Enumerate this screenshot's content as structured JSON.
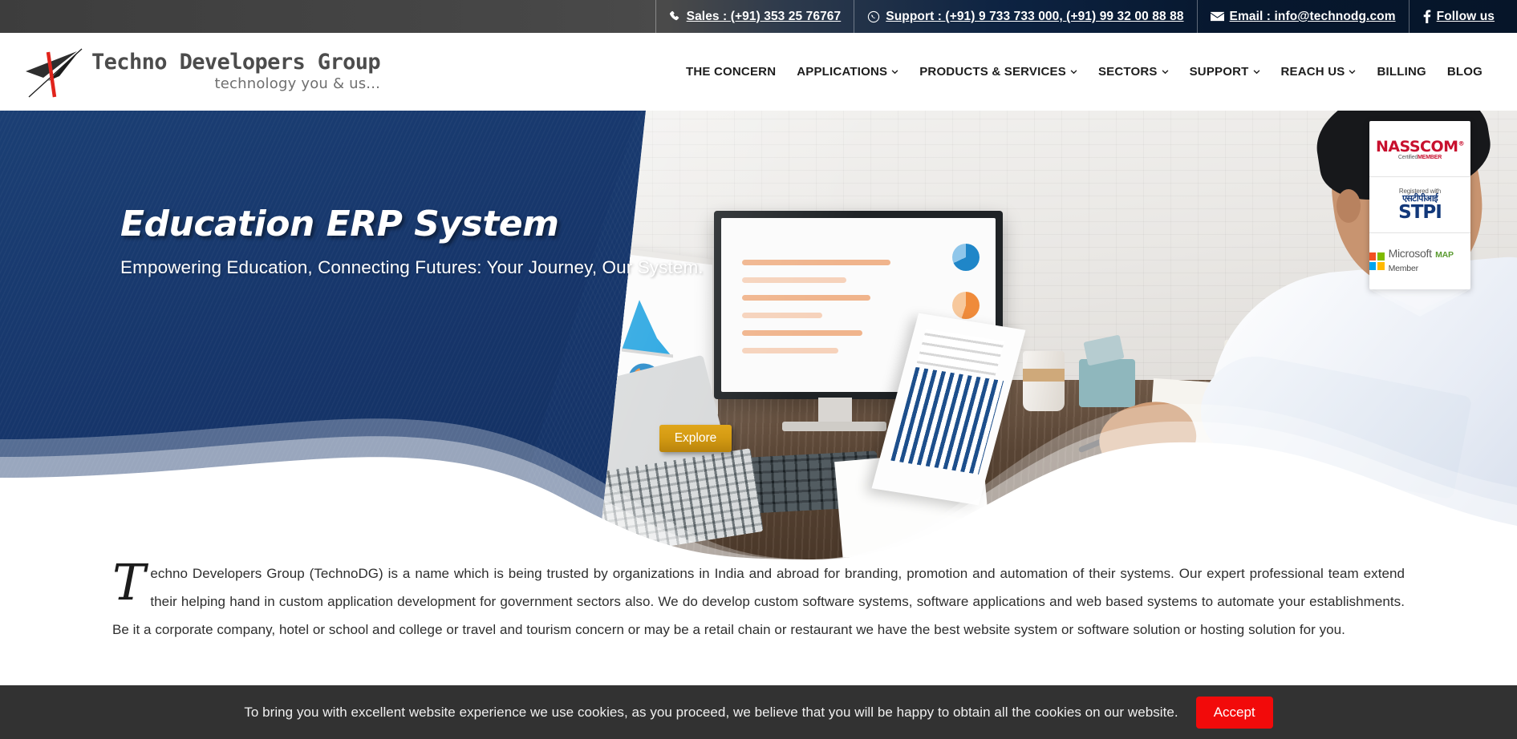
{
  "topbar": {
    "items": [
      {
        "icon": "phone-icon",
        "label": "Sales : (+91) 353 25 76767"
      },
      {
        "icon": "whatsapp-icon",
        "label": "Support : (+91) 9 733 733 000, (+91) 99 32 00 88 88"
      },
      {
        "icon": "envelope-icon",
        "label": "Email : info@technodg.com"
      },
      {
        "icon": "facebook-icon",
        "label": "Follow us"
      }
    ]
  },
  "logo": {
    "title": "Techno Developers Group",
    "tagline": "technology you & us...",
    "mark": "slash-arrow-logo-icon"
  },
  "nav": {
    "items": [
      {
        "label": "THE CONCERN",
        "has_dropdown": false
      },
      {
        "label": "APPLICATIONS",
        "has_dropdown": true
      },
      {
        "label": "PRODUCTS & SERVICES",
        "has_dropdown": true
      },
      {
        "label": "SECTORS",
        "has_dropdown": true
      },
      {
        "label": "SUPPORT",
        "has_dropdown": true
      },
      {
        "label": "REACH US",
        "has_dropdown": true
      },
      {
        "label": "BILLING",
        "has_dropdown": false
      },
      {
        "label": "BLOG",
        "has_dropdown": false
      }
    ]
  },
  "hero": {
    "title": "Education ERP System",
    "subtitle": "Empowering Education, Connecting Futures: Your Journey, Our System.",
    "cta_label": "Explore",
    "background_color": "#16356a",
    "cta_color": "#d39a12"
  },
  "badges": [
    {
      "name": "nasscom-badge",
      "main": "NASSCOM",
      "registered_mark": "®",
      "sub_light": "Certified",
      "sub_bold": "MEMBER"
    },
    {
      "name": "stpi-badge",
      "top": "Registered with",
      "hindi": "एसटीपीआई",
      "main": "STPI"
    },
    {
      "name": "microsoft-map-member-badge",
      "brand": "Microsoft",
      "role_accent": "MAP",
      "role_rest": " Member",
      "tile_colors": [
        "#f25022",
        "#7fba00",
        "#00a4ef",
        "#ffb900"
      ]
    }
  ],
  "about": {
    "dropcap": "T",
    "paragraph": "echno Developers Group (TechnoDG) is a name which is being trusted by organizations in India and abroad for branding, promotion and automation of their systems. Our expert professional team extend their helping hand in custom application development for government sectors also. We do develop custom software systems, software applications and web based systems to automate your establishments. Be it a corporate company, hotel or school and college or travel and tourism concern or may be a retail chain or restaurant we have the best website system or software solution or hosting solution for you."
  },
  "cookie": {
    "text": "To bring you with excellent website experience we use cookies, as you proceed, we believe that you will be happy to obtain all the cookies on our website.",
    "accept_label": "Accept",
    "accept_color": "#f20a0a",
    "bar_color": "#323232"
  }
}
